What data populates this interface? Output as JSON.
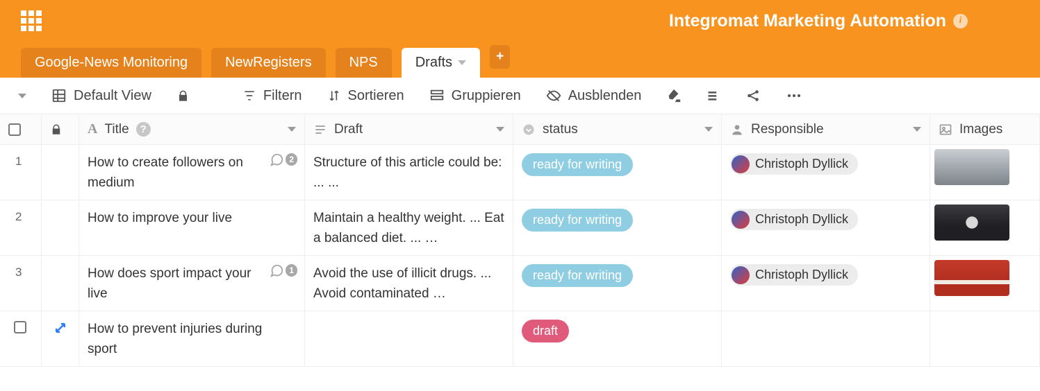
{
  "header": {
    "base_title": "Integromat Marketing Automation"
  },
  "tabs": [
    {
      "label": "Google-News Monitoring",
      "active": false
    },
    {
      "label": "NewRegisters",
      "active": false
    },
    {
      "label": "NPS",
      "active": false
    },
    {
      "label": "Drafts",
      "active": true
    }
  ],
  "toolbar": {
    "view_label": "Default View",
    "filter_label": "Filtern",
    "sort_label": "Sortieren",
    "group_label": "Gruppieren",
    "hide_label": "Ausblenden"
  },
  "columns": {
    "title": "Title",
    "draft": "Draft",
    "status": "status",
    "responsible": "Responsible",
    "images": "Images"
  },
  "rows": [
    {
      "num": "1",
      "title": "How to create followers on medium",
      "comments": "2",
      "draft": "Structure of this article could be: ... ...",
      "status_label": "ready for writing",
      "status_kind": "ready",
      "responsible": "Christoph Dyllick",
      "image_class": "t1"
    },
    {
      "num": "2",
      "title": "How to improve your live",
      "comments": "",
      "draft": "Maintain a healthy weight. ... Eat a balanced diet. ... …",
      "status_label": "ready for writing",
      "status_kind": "ready",
      "responsible": "Christoph Dyllick",
      "image_class": "t2"
    },
    {
      "num": "3",
      "title": "How does sport impact your live",
      "comments": "1",
      "draft": "Avoid the use of illicit drugs. ... Avoid contaminated …",
      "status_label": "ready for writing",
      "status_kind": "ready",
      "responsible": "Christoph Dyllick",
      "image_class": "t3"
    },
    {
      "num": "",
      "title": "How to prevent injuries during sport",
      "comments": "",
      "draft": "",
      "status_label": "draft",
      "status_kind": "draft",
      "responsible": "",
      "image_class": ""
    }
  ]
}
